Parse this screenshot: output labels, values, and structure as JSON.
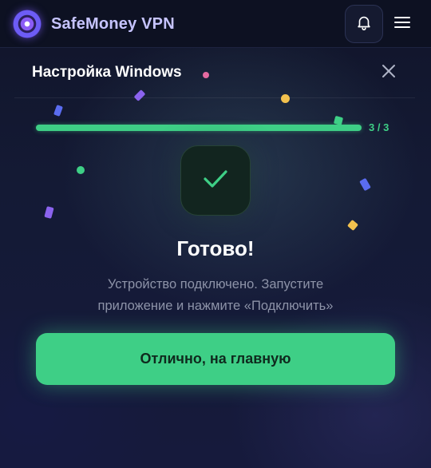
{
  "header": {
    "brand": "SafeMoney VPN"
  },
  "dialog": {
    "title": "Настройка Windows",
    "progress": {
      "current": 3,
      "total": 3,
      "label": "3 / 3",
      "fraction": 1.0
    },
    "status_title": "Готово!",
    "description_line1": "Устройство подключено. Запустите",
    "description_line2": "приложение и нажмите «Подключить»",
    "cta_label": "Отлично, на главную"
  },
  "colors": {
    "accent": "#3ecf86",
    "brand_text": "#c6c4ff",
    "background": "#11152a",
    "muted_text": "#8d93a8"
  },
  "icons": {
    "logo": "vpn-logo-icon",
    "bell": "bell-icon",
    "menu": "hamburger-menu-icon",
    "close": "close-icon",
    "success": "checkmark-icon"
  }
}
